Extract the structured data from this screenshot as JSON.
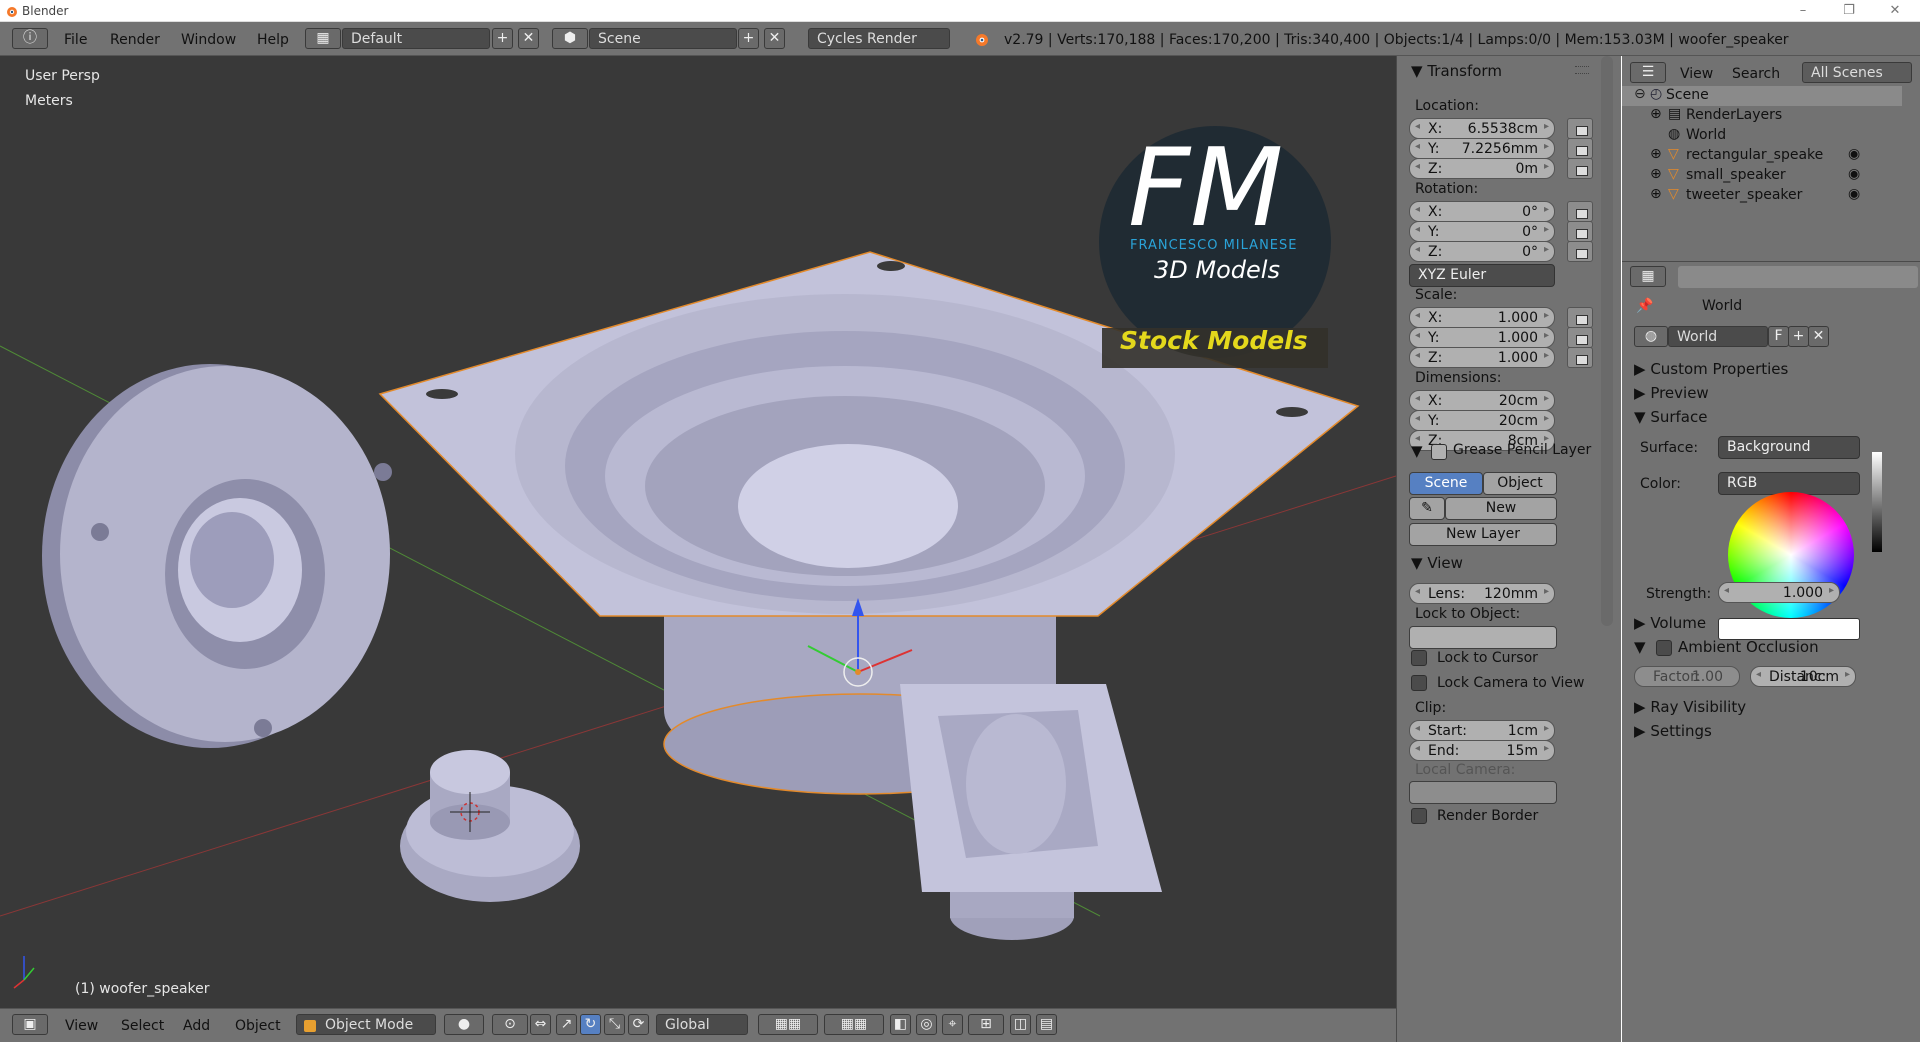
{
  "window": {
    "title": "Blender",
    "minimize": "–",
    "maximize": "❐",
    "close": "✕"
  },
  "info": {
    "menus": [
      "File",
      "Render",
      "Window",
      "Help"
    ],
    "layout": "Default",
    "scene": "Scene",
    "engine": "Cycles Render",
    "stats": "v2.79 | Verts:170,188 | Faces:170,200 | Tris:340,400 | Objects:1/4 | Lamps:0/0 | Mem:153.03M | woofer_speaker"
  },
  "viewport": {
    "persp": "User Persp",
    "units": "Meters",
    "active_object": "(1) woofer_speaker",
    "logo": {
      "mark": "FM",
      "name": "FRANCESCO MILANESE",
      "sub": "3D Models",
      "banner": "Stock Models"
    },
    "bg": "#393939"
  },
  "viewport_header": {
    "menus": [
      "View",
      "Select",
      "Add",
      "Object"
    ],
    "mode": "Object Mode",
    "orientation": "Global"
  },
  "transform": {
    "title": "Transform",
    "location_label": "Location:",
    "location": [
      {
        "k": "X:",
        "v": "6.5538cm"
      },
      {
        "k": "Y:",
        "v": "7.2256mm"
      },
      {
        "k": "Z:",
        "v": "0m"
      }
    ],
    "rotation_label": "Rotation:",
    "rotation": [
      {
        "k": "X:",
        "v": "0°"
      },
      {
        "k": "Y:",
        "v": "0°"
      },
      {
        "k": "Z:",
        "v": "0°"
      }
    ],
    "rotation_mode": "XYZ Euler",
    "scale_label": "Scale:",
    "scale": [
      {
        "k": "X:",
        "v": "1.000"
      },
      {
        "k": "Y:",
        "v": "1.000"
      },
      {
        "k": "Z:",
        "v": "1.000"
      }
    ],
    "dimensions_label": "Dimensions:",
    "dimensions": [
      {
        "k": "X:",
        "v": "20cm"
      },
      {
        "k": "Y:",
        "v": "20cm"
      },
      {
        "k": "Z:",
        "v": "8cm"
      }
    ]
  },
  "grease": {
    "title": "Grease Pencil Layer",
    "scene": "Scene",
    "object": "Object",
    "new": "New",
    "new_layer": "New Layer"
  },
  "view": {
    "title": "View",
    "lens_k": "Lens:",
    "lens_v": "120mm",
    "lock_obj": "Lock to Object:",
    "lock_cursor": "Lock to Cursor",
    "lock_camera": "Lock Camera to View",
    "clip": "Clip:",
    "start_k": "Start:",
    "start_v": "1cm",
    "end_k": "End:",
    "end_v": "15m",
    "local_camera": "Local Camera:",
    "render_border": "Render Border"
  },
  "outliner": {
    "menus": [
      "View",
      "Search"
    ],
    "filter": "All Scenes",
    "items": [
      "Scene",
      "RenderLayers",
      "World",
      "rectangular_speake",
      "small_speaker",
      "tweeter_speaker"
    ]
  },
  "world_panel": {
    "breadcrumb": "World",
    "world_name": "World",
    "fake": "F",
    "sections": {
      "custom": "Custom Properties",
      "preview": "Preview",
      "surface": "Surface"
    },
    "surface_k": "Surface:",
    "surface_v": "Background",
    "color_k": "Color:",
    "color_v": "RGB",
    "strength_k": "Strength:",
    "strength_v": "1.000",
    "volume": "Volume",
    "ao": "Ambient Occlusion",
    "factor_k": "Factor:",
    "factor_v": "1.00",
    "distance_k": "Distanc:",
    "distance_v": "10cm",
    "ray": "Ray Visibility",
    "settings": "Settings"
  },
  "colors": {
    "panel": "#727272",
    "viewport": "#393939",
    "accent": "#5680c2",
    "brand_blue": "#2aa3d8",
    "banner_text": "#e4d81c"
  }
}
